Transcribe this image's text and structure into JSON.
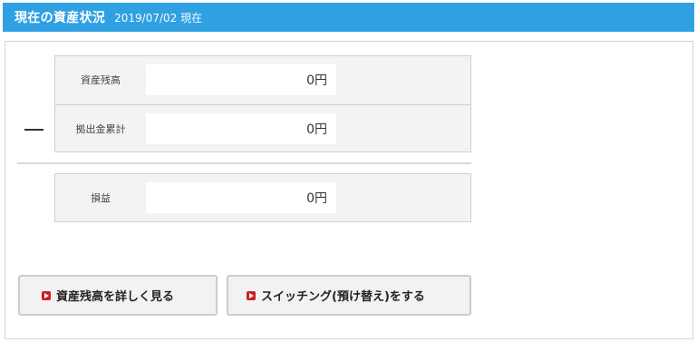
{
  "header": {
    "title": "現在の資産状況",
    "date": "2019/07/02 現在"
  },
  "calc": {
    "operator_symbol": "minus",
    "rows": [
      {
        "label": "資産残高",
        "value": "0円"
      },
      {
        "label": "拠出金累計",
        "value": "0円"
      }
    ],
    "result": {
      "label": "損益",
      "value": "0円"
    }
  },
  "actions": {
    "detail_label": "資産残高を詳しく見る",
    "switch_label": "スイッチング(預け替え)をする",
    "icon": "play-icon",
    "icon_color": "#cc1f1f"
  },
  "colors": {
    "header_bg": "#2fa1e3",
    "box_bg": "#f3f3f3"
  }
}
